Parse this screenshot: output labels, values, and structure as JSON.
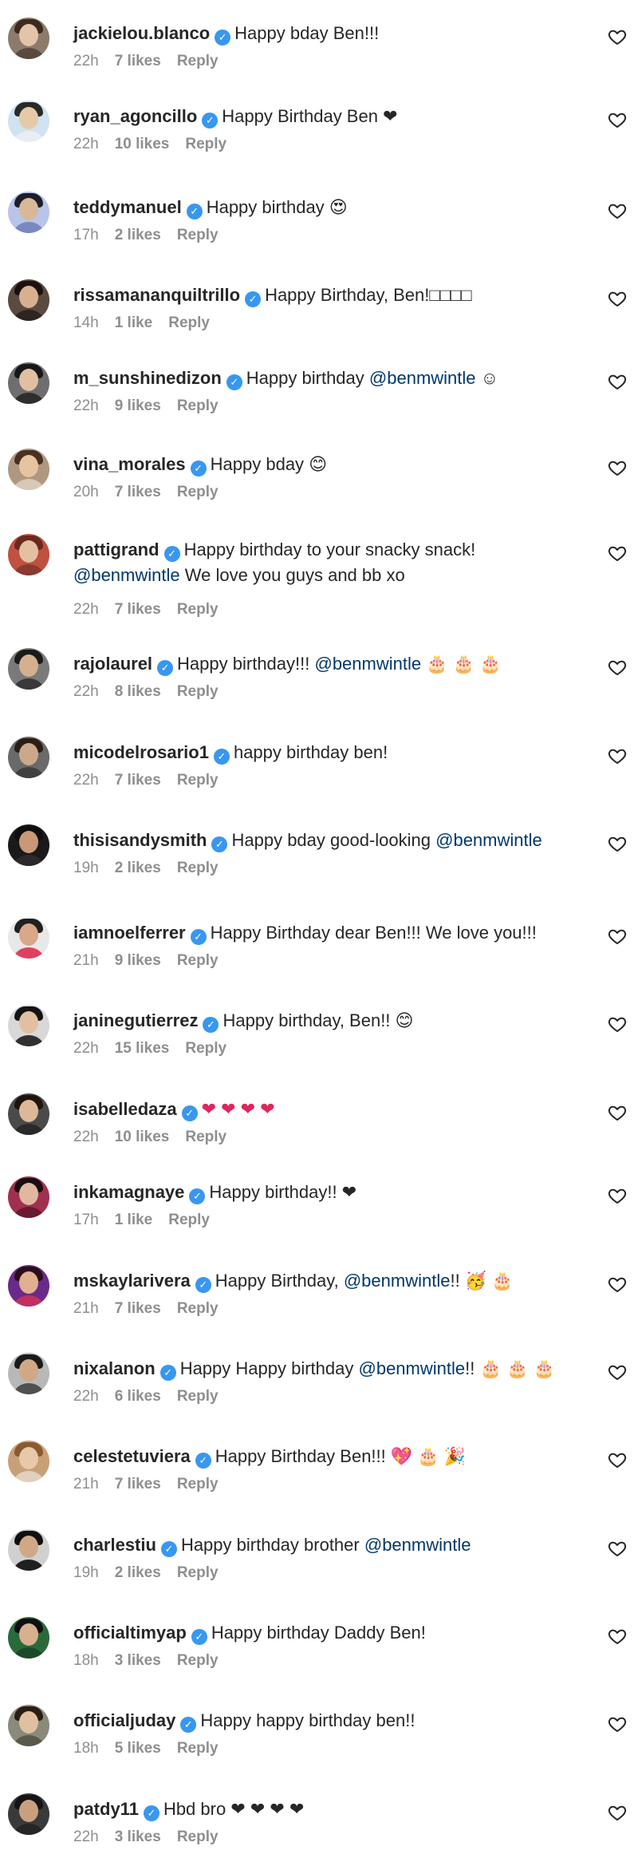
{
  "comments": [
    {
      "username": "jackielou.blanco",
      "text": "Happy bday Ben!!!",
      "time": "22h",
      "likes": "7 likes",
      "reply": "Reply",
      "avatar_colors": [
        "#8c7b6b",
        "#e2c4a8",
        "#3b2a1f",
        "#5a4a3e"
      ]
    },
    {
      "username": "ryan_agoncillo",
      "text": "Happy Birthday Ben ❤",
      "time": "22h",
      "likes": "10 likes",
      "reply": "Reply",
      "avatar_colors": [
        "#cfe3f0",
        "#e6c9a6",
        "#2a2a2a",
        "#e8eef3"
      ]
    },
    {
      "username": "teddymanuel",
      "text": "Happy birthday 😍",
      "time": "17h",
      "likes": "2 likes",
      "reply": "Reply",
      "avatar_colors": [
        "#b8c4e8",
        "#d9b898",
        "#1e1e2a",
        "#7a88c0"
      ]
    },
    {
      "username": "rissamananquiltrillo",
      "text": "Happy Birthday, Ben!□□□□",
      "time": "14h",
      "likes": "1 like",
      "reply": "Reply",
      "avatar_colors": [
        "#5a4a40",
        "#d8b090",
        "#1a1210",
        "#2e2420"
      ]
    },
    {
      "username": "m_sunshinedizon",
      "text": "Happy birthday",
      "mention": "@benmwintle",
      "suffix": " ☺",
      "time": "22h",
      "likes": "9 likes",
      "reply": "Reply",
      "avatar_colors": [
        "#6e6e6e",
        "#e0c0a0",
        "#181818",
        "#2e2e2e"
      ]
    },
    {
      "username": "vina_morales",
      "text": "Happy bday 😊",
      "time": "20h",
      "likes": "7 likes",
      "reply": "Reply",
      "avatar_colors": [
        "#b09880",
        "#e6c4a2",
        "#4a3020",
        "#d8c8b8"
      ]
    },
    {
      "username": "pattigrand",
      "text": "Happy birthday to your snacky snack!",
      "mention": "@benmwintle",
      "suffix": " We love you guys and bb xo",
      "wrap": true,
      "time": "22h",
      "likes": "7 likes",
      "reply": "Reply",
      "avatar_colors": [
        "#c05040",
        "#e4c0a0",
        "#6a2a1e",
        "#8a3a30"
      ]
    },
    {
      "username": "rajolaurel",
      "text": "Happy birthday!!!",
      "mention": "@benmwintle",
      "suffix": " 🎂 🎂 🎂",
      "time": "22h",
      "likes": "8 likes",
      "reply": "Reply",
      "avatar_colors": [
        "#7a7a7a",
        "#d4b090",
        "#1a1a1a",
        "#3a3a3a"
      ]
    },
    {
      "username": "micodelrosario1",
      "text": "happy birthday ben!",
      "time": "22h",
      "likes": "7 likes",
      "reply": "Reply",
      "avatar_colors": [
        "#6a6a6a",
        "#cca88a",
        "#2a1e16",
        "#404040"
      ]
    },
    {
      "username": "thisisandysmith",
      "text": "Happy bday good-looking",
      "mention": "@benmwintle",
      "time": "19h",
      "likes": "2 likes",
      "reply": "Reply",
      "avatar_colors": [
        "#1a1a1a",
        "#c89878",
        "#0e0e0e",
        "#2a2a2a"
      ]
    },
    {
      "username": "iamnoelferrer",
      "text": "Happy Birthday dear Ben!!! We love you!!!",
      "time": "21h",
      "likes": "9 likes",
      "reply": "Reply",
      "avatar_colors": [
        "#e8e8e8",
        "#d8a888",
        "#202020",
        "#e04060"
      ]
    },
    {
      "username": "janinegutierrez",
      "text": "Happy birthday, Ben!! 😊",
      "time": "22h",
      "likes": "15 likes",
      "reply": "Reply",
      "avatar_colors": [
        "#d8d8d8",
        "#e0c0a0",
        "#141414",
        "#303030"
      ]
    },
    {
      "username": "isabelledaza",
      "text": "❤ ❤ ❤ ❤",
      "red": true,
      "time": "22h",
      "likes": "10 likes",
      "reply": "Reply",
      "avatar_colors": [
        "#4a4a4a",
        "#dcb898",
        "#1e140e",
        "#2a2a2a"
      ]
    },
    {
      "username": "inkamagnaye",
      "text": "Happy birthday!! ❤",
      "time": "17h",
      "likes": "1 like",
      "reply": "Reply",
      "avatar_colors": [
        "#a03050",
        "#e0b8a0",
        "#1a0e0e",
        "#6a1a30"
      ]
    },
    {
      "username": "mskaylarivera",
      "text": "Happy Birthday,",
      "mention": "@benmwintle",
      "suffix": "!! 🥳 🎂",
      "time": "21h",
      "likes": "7 likes",
      "reply": "Reply",
      "avatar_colors": [
        "#6a2a8a",
        "#e0b090",
        "#2a0e1a",
        "#c03060"
      ]
    },
    {
      "username": "nixalanon",
      "text": "Happy Happy birthday",
      "mention": "@benmwintle",
      "suffix": "!! 🎂 🎂 🎂",
      "time": "22h",
      "likes": "6 likes",
      "reply": "Reply",
      "avatar_colors": [
        "#b8b8b8",
        "#d0a888",
        "#1a1a1a",
        "#505050"
      ]
    },
    {
      "username": "celestetuviera",
      "text": "Happy Birthday Ben!!! 💖 🎂 🎉",
      "time": "21h",
      "likes": "7 likes",
      "reply": "Reply",
      "avatar_colors": [
        "#c8a078",
        "#e8c8a8",
        "#8a5a30",
        "#e0d0c0"
      ]
    },
    {
      "username": "charlestiu",
      "text": "Happy birthday brother",
      "mention": "@benmwintle",
      "time": "19h",
      "likes": "2 likes",
      "reply": "Reply",
      "avatar_colors": [
        "#d0d0d0",
        "#d0a888",
        "#101010",
        "#202020"
      ]
    },
    {
      "username": "officialtimyap",
      "text": "Happy birthday Daddy Ben!",
      "time": "18h",
      "likes": "3 likes",
      "reply": "Reply",
      "avatar_colors": [
        "#2a6a3a",
        "#d8b090",
        "#101010",
        "#1a4a2a"
      ]
    },
    {
      "username": "officialjuday",
      "text": "Happy happy birthday ben!!",
      "time": "18h",
      "likes": "5 likes",
      "reply": "Reply",
      "avatar_colors": [
        "#8a8a7a",
        "#e0c0a0",
        "#2a1e14",
        "#5a5a4a"
      ]
    },
    {
      "username": "patdy11",
      "text": "Hbd bro ❤ ❤ ❤ ❤",
      "time": "22h",
      "likes": "3 likes",
      "reply": "Reply",
      "avatar_colors": [
        "#3a3a3a",
        "#c8a080",
        "#141414",
        "#262626"
      ]
    }
  ]
}
